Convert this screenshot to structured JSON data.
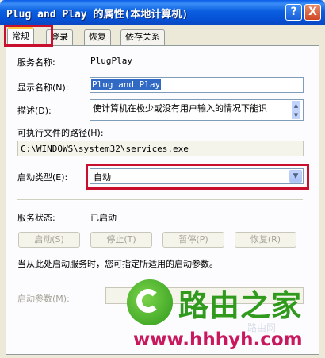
{
  "window": {
    "title": "Plug and Play 的属性(本地计算机)",
    "help_btn": "?",
    "close_btn": "X"
  },
  "tabs": [
    {
      "label": "常规",
      "active": true
    },
    {
      "label": "登录",
      "active": false
    },
    {
      "label": "恢复",
      "active": false
    },
    {
      "label": "依存关系",
      "active": false
    }
  ],
  "general": {
    "service_name_label": "服务名称:",
    "service_name": "PlugPlay",
    "display_name_label": "显示名称(N):",
    "display_name": "Plug and Play",
    "description_label": "描述(D):",
    "description": "使计算机在极少或没有用户输入的情况下能识",
    "exe_path_label": "可执行文件的路径(H):",
    "exe_path": "C:\\WINDOWS\\system32\\services.exe",
    "startup_type_label": "启动类型(E):",
    "startup_type": "自动",
    "service_status_label": "服务状态:",
    "service_status": "已启动",
    "start_button": "启动(S)",
    "stop_button": "停止(T)",
    "pause_button": "暂停(P)",
    "resume_button": "恢复(R)",
    "hint_text": "当从此处启动服务时，您可指定所适用的启动参数。",
    "start_params_label": "启动参数(M):"
  },
  "watermark": {
    "brand": "路由之家",
    "url": "www.hhhyh.com",
    "faint": "路由网"
  },
  "colors": {
    "titlebar": "#0a5ce8",
    "highlight_box": "#c8102e",
    "watermark_green": "#2f9a1c",
    "watermark_pink": "#c8185e"
  }
}
